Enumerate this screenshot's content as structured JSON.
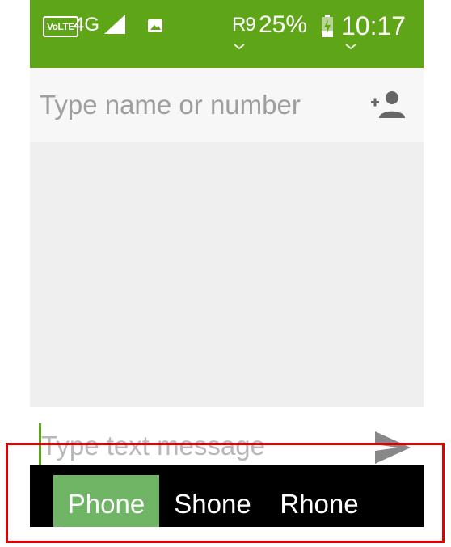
{
  "status_bar": {
    "volte_label": "VoLTE",
    "network_label": "4G",
    "carrier_label": "R9",
    "battery_percent": "25%",
    "time": "10:17",
    "background_color": "#5fa518",
    "icons": [
      "signal-icon",
      "photo-notification-icon",
      "battery-charging-icon"
    ]
  },
  "recipient": {
    "placeholder": "Type name or number",
    "value": "",
    "add_contact_icon": "add-person-icon"
  },
  "compose": {
    "placeholder": "Type text message",
    "value": "",
    "send_icon": "send-icon",
    "cursor_color": "#5fa518"
  },
  "keyboard_suggestions": {
    "items": [
      "Phone",
      "Shone",
      "Rhone"
    ],
    "selected_index": 0,
    "selected_color": "#6fb565"
  },
  "annotation": {
    "highlight_color": "#e00000"
  }
}
